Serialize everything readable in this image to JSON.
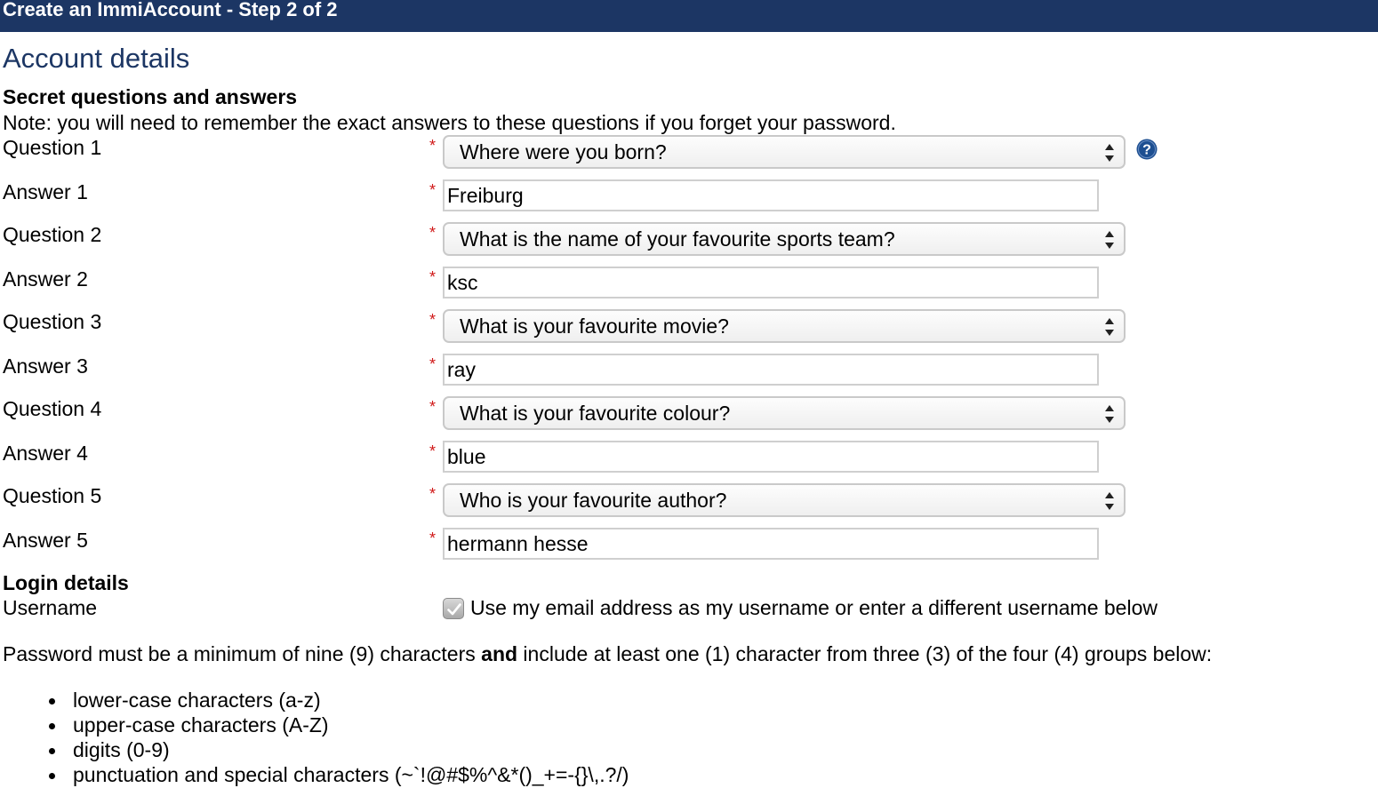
{
  "header": {
    "title": "Create an ImmiAccount - Step 2 of 2"
  },
  "main": {
    "section_title": "Account details",
    "secret_questions": {
      "heading": "Secret questions and answers",
      "note": "Note: you will need to remember the exact answers to these questions if you forget your password.",
      "required_marker": "*",
      "items": [
        {
          "question_label": "Question 1",
          "question_value": "Where were you born?",
          "answer_label": "Answer 1",
          "answer_value": "Freiburg"
        },
        {
          "question_label": "Question 2",
          "question_value": "What is the name of your favourite sports team?",
          "answer_label": "Answer 2",
          "answer_value": "ksc"
        },
        {
          "question_label": "Question 3",
          "question_value": "What is your favourite movie?",
          "answer_label": "Answer 3",
          "answer_value": "ray"
        },
        {
          "question_label": "Question 4",
          "question_value": "What is your favourite colour?",
          "answer_label": "Answer 4",
          "answer_value": "blue"
        },
        {
          "question_label": "Question 5",
          "question_value": "Who is your favourite author?",
          "answer_label": "Answer 5",
          "answer_value": "hermann hesse"
        }
      ]
    },
    "login": {
      "heading": "Login details",
      "username_label": "Username",
      "use_email_checked": true,
      "use_email_label": "Use my email address as my username or enter a different username below"
    },
    "password": {
      "rule_before": "Password must be a minimum of nine (9) characters ",
      "rule_bold": "and",
      "rule_after": " include at least one (1) character from three (3) of the four (4) groups below:",
      "groups": [
        "lower-case characters (a-z)",
        "upper-case characters (A-Z)",
        "digits (0-9)",
        "punctuation and special characters (~`!@#$%^&*()_+=-{}\\,.?/)"
      ]
    }
  },
  "icons": {
    "help": "question-circle-icon",
    "select_arrows": "up-down-arrows-icon",
    "checkmark": "checkmark-icon"
  },
  "colors": {
    "header_bg": "#1c3664",
    "heading_text": "#1c3664",
    "required": "#d01818",
    "help_icon": "#1d4f91"
  }
}
